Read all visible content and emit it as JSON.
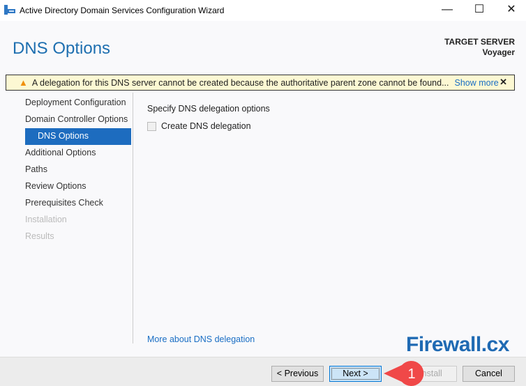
{
  "window": {
    "title": "Active Directory Domain Services Configuration Wizard",
    "minimize": "—",
    "maximize": "☐",
    "close": "✕"
  },
  "header": {
    "title": "DNS Options",
    "target_label": "TARGET SERVER",
    "target_name": "Voyager"
  },
  "warning": {
    "icon": "warning-triangle-icon",
    "message": "A delegation for this DNS server cannot be created because the authoritative parent zone cannot be found...",
    "show_more": "Show more",
    "close": "✕"
  },
  "nav": {
    "items": [
      {
        "label": "Deployment Configuration",
        "state": "normal"
      },
      {
        "label": "Domain Controller Options",
        "state": "normal"
      },
      {
        "label": "DNS Options",
        "state": "selected"
      },
      {
        "label": "Additional Options",
        "state": "normal"
      },
      {
        "label": "Paths",
        "state": "normal"
      },
      {
        "label": "Review Options",
        "state": "normal"
      },
      {
        "label": "Prerequisites Check",
        "state": "normal"
      },
      {
        "label": "Installation",
        "state": "disabled"
      },
      {
        "label": "Results",
        "state": "disabled"
      }
    ]
  },
  "main": {
    "section_label": "Specify DNS delegation options",
    "checkbox_label": "Create DNS delegation",
    "checkbox_checked": false,
    "more_link": "More about DNS delegation"
  },
  "buttons": {
    "previous": "< Previous",
    "next": "Next >",
    "install": "Install",
    "cancel": "Cancel"
  },
  "annotation": {
    "callout_number": "1",
    "callout_color": "#f04848"
  },
  "watermark": {
    "text": "Firewall.cx"
  }
}
